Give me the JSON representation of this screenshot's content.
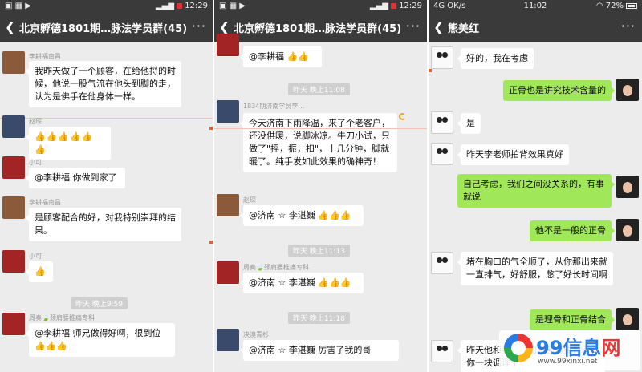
{
  "panel1": {
    "status": {
      "left": "",
      "right": "12:29"
    },
    "title": "北京孵德1801期…脉法学员群(45)",
    "messages": {
      "m1_sender": "李耕福南昌",
      "m1_text": "我昨天做了一个顾客，在给他捋的时候，他说一股气流在他头到脚的走，认为是佛手在他身体一样。",
      "m2_sender": "赵琛",
      "m2_text": "👍👍👍👍👍👍",
      "m3_sender": "小可",
      "m3_text": "@李耕福  你做到家了",
      "m4_sender": "李耕福南昌",
      "m4_text": "是顾客配合的好，对我特别崇拜的结果。",
      "m5_sender": "小可",
      "m5_text": "👍",
      "time1": "昨天 晚上9:59",
      "m6_sender": "周奏🍃颈肩腰椎痛专科",
      "m6_text": "@李耕福  师兄做得好啊，很到位👍👍👍"
    }
  },
  "panel2": {
    "status": {
      "left": "",
      "right": "12:29"
    },
    "title": "北京孵德1801期…脉法学员群(45)",
    "messages": {
      "m0_text": "@李耕福 👍👍",
      "time1": "昨天 晚上11:08",
      "m1_sender": "1834期济南学员李…",
      "m1_text": "今天济南下雨降温，来了个老客户，还没供暖，说脚冰凉。牛刀小试，只做了\"摇，振，扣\"，十几分钟，脚就暖了。纯手发如此效果的确神奇！",
      "m2_sender": "赵琛",
      "m2_text": "@济南 ☆ 李湛巍 👍👍👍",
      "time2": "昨天 晚上11:13",
      "m3_sender": "周奏🍃颈肩腰椎痛专科",
      "m3_text": "@济南 ☆ 李湛巍 👍👍👍",
      "time3": "昨天 晚上11:18",
      "m4_sender": "决漠青杉",
      "m4_text": "@济南 ☆ 李湛巍  厉害了我的哥"
    }
  },
  "panel3": {
    "status": {
      "left": "4G OK/s",
      "center": "11:02",
      "right": "72%"
    },
    "title": "熊美红",
    "messages": {
      "m1_text": "好的，我在考虑",
      "m2_text": "正骨也是讲究技术含量的",
      "m3_text": "是",
      "m4_text": "昨天李老师拍背效果真好",
      "m5_text": "自己考虑，我们之间没关系的，有事就说",
      "m6_text": "他不是一般的正骨",
      "m7_text": "堵在胸口的气全顺了，从你那出来就一直排气，好舒服，憋了好长时间啊",
      "m8_text": "是理骨和正骨结合",
      "m9_text": "昨天他和我说你的腰部需要调理 你一块调理下"
    }
  },
  "watermark": {
    "brand_num": "99",
    "brand_text": "信息",
    "brand_net": "网",
    "url": "www.99xinxi.net"
  },
  "colors": {
    "titlebar": "#3a3a3a",
    "chat_bg": "#ececec",
    "bubble_green": "#a0e759",
    "thumbs": "#e9a82a"
  }
}
